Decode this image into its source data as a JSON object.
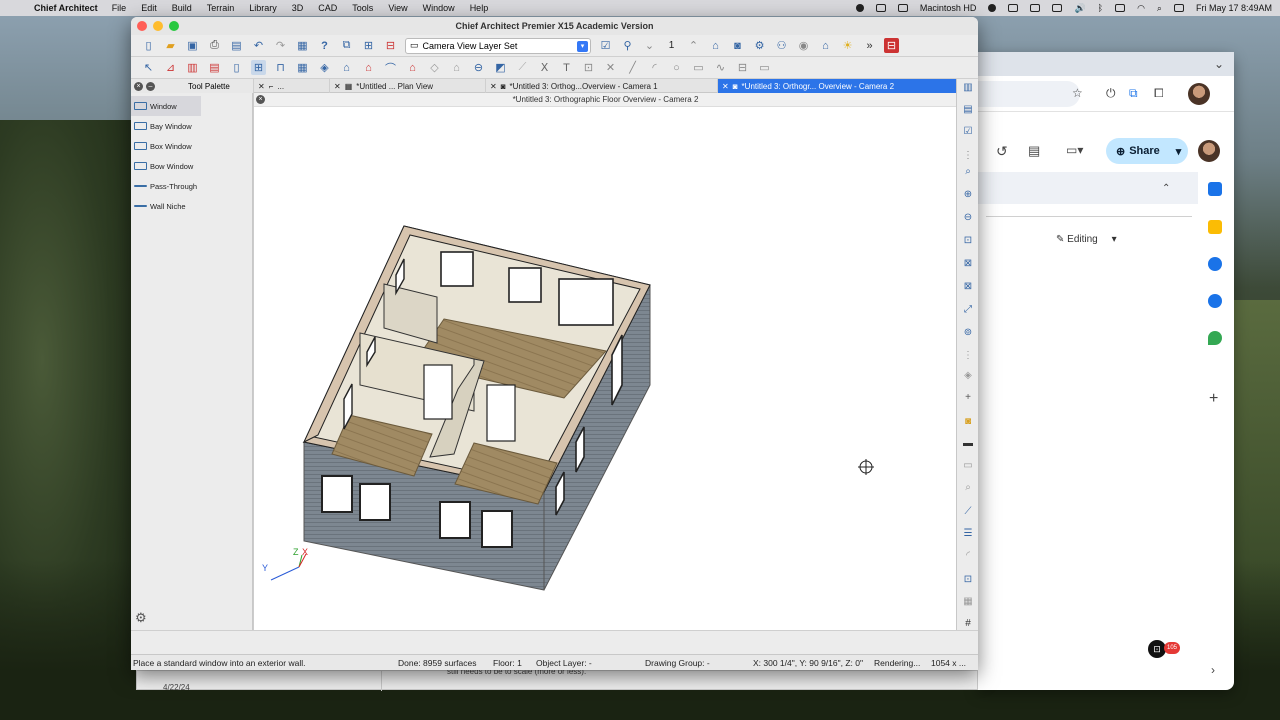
{
  "menubar": {
    "app": "Chief Architect",
    "items": [
      "File",
      "Edit",
      "Build",
      "Terrain",
      "Library",
      "3D",
      "CAD",
      "Tools",
      "View",
      "Window",
      "Help"
    ],
    "disk": "Macintosh HD",
    "datetime": "Fri May 17  8:49AM"
  },
  "window": {
    "title": "Chief Architect Premier X15 Academic Version",
    "layer_set": "Camera View Layer Set",
    "floor_count": "1"
  },
  "palette": {
    "title": "Tool Palette",
    "items": [
      "Window",
      "Bay Window",
      "Box Window",
      "Bow Window",
      "Pass-Through",
      "Wall Niche"
    ]
  },
  "tabs": {
    "t0": "...",
    "t1": "*Untitled ... Plan View",
    "t2": "*Untitled 3: Orthog...Overview - Camera 1",
    "t3": "*Untitled 3: Orthogr... Overview - Camera 2"
  },
  "canvas": {
    "title": "*Untitled 3: Orthographic Floor Overview - Camera 2",
    "axis_y": "Y",
    "axis_z": "Z",
    "axis_x": "X"
  },
  "status": {
    "hint": "Place a standard window into an exterior wall.",
    "done": "Done:  8959 surfaces",
    "floor": "Floor: 1",
    "object_layer": "Object Layer: -",
    "drawing_group": "Drawing Group: -",
    "coords": "X: 300 1/4\", Y: 90 9/16\", Z: 0\"",
    "rendering": "Rendering...",
    "size": "1054 x ..."
  },
  "behind": {
    "date": "4/22/24",
    "text": "still needs to be to scale (more or less)."
  },
  "chrome": {
    "share": "Share",
    "editing": "Editing",
    "badge": "105"
  },
  "colors": {
    "accent": "#2c74e8",
    "share_bg": "#c2e7ff",
    "siding": "#7d8791",
    "wall_interior": "#e9e4d6",
    "floor_wood": "#a08a63"
  }
}
